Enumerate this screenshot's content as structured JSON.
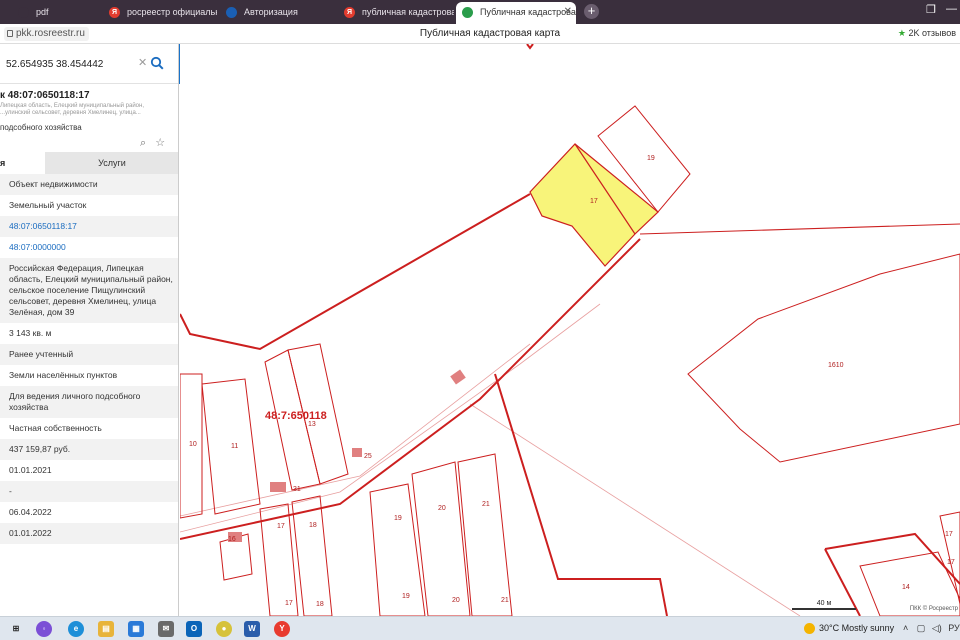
{
  "browser": {
    "tabs": [
      {
        "label": "pdf",
        "icon": "tab-generic-icon",
        "color": "#3a2f3d"
      },
      {
        "label": "росреестр официальный",
        "icon": "yandex-icon",
        "color": "#e23c2f"
      },
      {
        "label": "Авторизация",
        "icon": "gosuslugi-icon",
        "color": "#1a5fb4"
      },
      {
        "label": "публичная кадастровая к",
        "icon": "yandex-icon",
        "color": "#e23c2f"
      },
      {
        "label": "Публичная кадастрова",
        "icon": "pkk-icon",
        "color": "#2a9d4b"
      }
    ],
    "url": "pkk.rosreestr.ru",
    "page_title": "Публичная кадастровая карта",
    "reviews": "2K отзывов"
  },
  "search": {
    "value": "52.654935 38.454442"
  },
  "object": {
    "title": "к 48:07:0650118:17",
    "address_short": "Липецкая область, Елецкий муниципальный район, ...улинский сельсовет, деревня Хмелинец, улица...",
    "purpose": "подсобного хозяйства"
  },
  "tabs": {
    "info": "я",
    "services": "Услуги"
  },
  "properties": [
    {
      "text": "Объект недвижимости",
      "link": false
    },
    {
      "text": "Земельный участок",
      "link": false
    },
    {
      "text": "48:07:0650118:17",
      "link": true
    },
    {
      "text": "48:07:0000000",
      "link": true
    },
    {
      "text": "Российская Федерация, Липецкая область, Елецкий муниципальный район, сельское поселение Пищулинский сельсовет, деревня Хмелинец, улица Зелёная, дом 39",
      "link": false
    },
    {
      "text": "3 143 кв. м",
      "link": false
    },
    {
      "text": "Ранее учтенный",
      "link": false
    },
    {
      "text": "Земли населённых пунктов",
      "link": false
    },
    {
      "text": "Для ведения личного подсобного хозяйства",
      "link": false
    },
    {
      "text": "Частная собственность",
      "link": false
    },
    {
      "text": "437 159,87 руб.",
      "link": false
    },
    {
      "text": "01.01.2021",
      "link": false
    },
    {
      "text": "-",
      "link": false
    },
    {
      "text": "06.04.2022",
      "link": false
    },
    {
      "text": "01.01.2022",
      "link": false
    }
  ],
  "map": {
    "quarter_label": "48:7:650118",
    "parcel_labels": [
      "19",
      "17",
      "1610",
      "13",
      "10",
      "11",
      "25",
      "31",
      "16",
      "17",
      "18",
      "19",
      "20",
      "21",
      "17",
      "18",
      "19",
      "20",
      "21",
      "14",
      "17",
      "17"
    ],
    "scale": "40 м",
    "attribution": "ПКК © Росреестр",
    "selected_color": "#f8f47a",
    "boundary_color": "#cc1f1f"
  },
  "taskbar": {
    "weather": "30°C  Mostly sunny",
    "tray": "РУС"
  }
}
